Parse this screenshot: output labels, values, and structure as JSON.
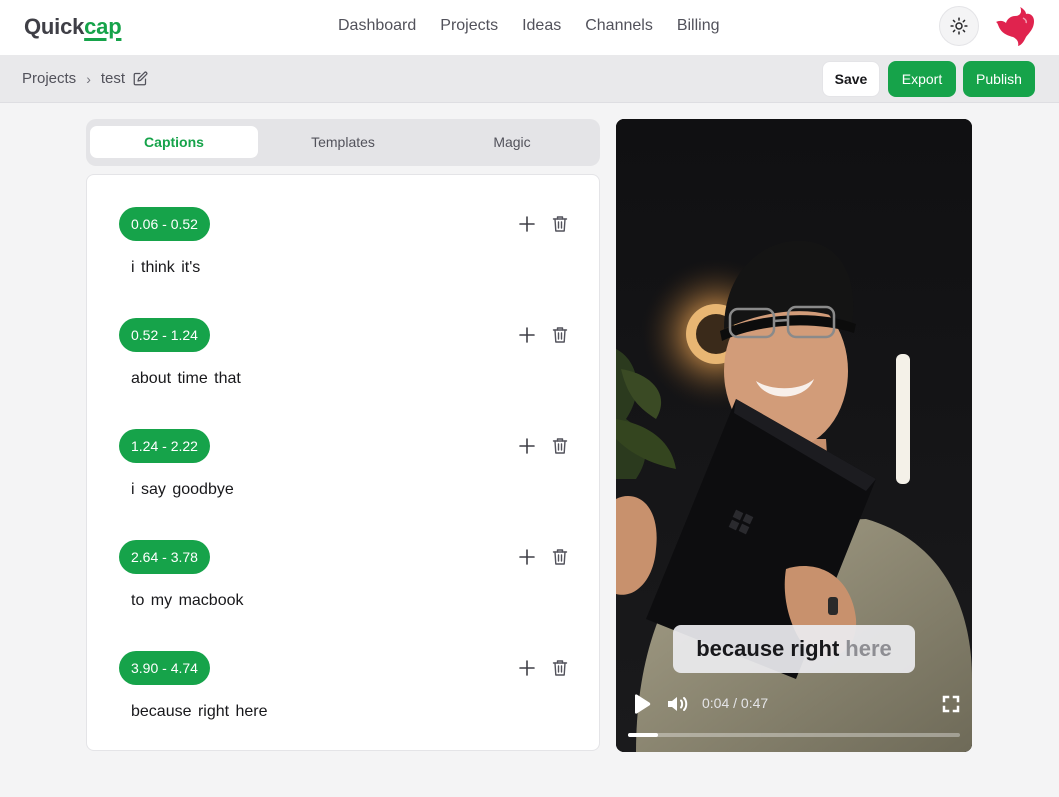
{
  "app": {
    "logo_prefix": "Quick",
    "logo_accent": "cap"
  },
  "nav": {
    "items": [
      {
        "label": "Dashboard"
      },
      {
        "label": "Projects"
      },
      {
        "label": "Ideas"
      },
      {
        "label": "Channels"
      },
      {
        "label": "Billing"
      }
    ]
  },
  "header_icons": {
    "theme": "sun-icon",
    "brand": "nestjs-logo-icon"
  },
  "breadcrumb": {
    "root": "Projects",
    "separator": "›",
    "current": "test",
    "edit_icon": "pencil-square-icon"
  },
  "actions": {
    "save": "Save",
    "export": "Export",
    "publish": "Publish"
  },
  "tabs": [
    {
      "label": "Captions",
      "active": true
    },
    {
      "label": "Templates",
      "active": false
    },
    {
      "label": "Magic",
      "active": false
    }
  ],
  "captions": [
    {
      "time": "0.06 - 0.52",
      "text": "i think it's"
    },
    {
      "time": "0.52 - 1.24",
      "text": "about time that"
    },
    {
      "time": "1.24 - 2.22",
      "text": "i say goodbye"
    },
    {
      "time": "2.64 - 3.78",
      "text": "to my macbook"
    },
    {
      "time": "3.90 - 4.74",
      "text": "because right here"
    }
  ],
  "caption_icons": {
    "add": "plus-icon",
    "delete": "trash-icon"
  },
  "video": {
    "subtitle_strong": "because right",
    "subtitle_dim": "here",
    "time": "0:04 / 0:47",
    "progress_fraction": 0.09
  },
  "colors": {
    "accent": "#16a34a",
    "brand_red": "#e0234e"
  }
}
